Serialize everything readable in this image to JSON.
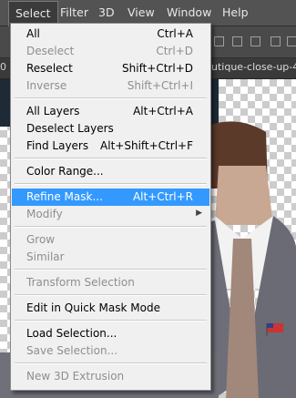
{
  "menubar": {
    "items": [
      "Select",
      "Filter",
      "3D",
      "View",
      "Window",
      "Help"
    ],
    "active": "Select"
  },
  "tabbar": {
    "left_fragment": "0",
    "tab_title": "utique-close-up-4"
  },
  "select_menu": {
    "items": [
      {
        "label": "All",
        "shortcut": "Ctrl+A",
        "enabled": true
      },
      {
        "label": "Deselect",
        "shortcut": "Ctrl+D",
        "enabled": false
      },
      {
        "label": "Reselect",
        "shortcut": "Shift+Ctrl+D",
        "enabled": true
      },
      {
        "label": "Inverse",
        "shortcut": "Shift+Ctrl+I",
        "enabled": false
      },
      {
        "label": "All Layers",
        "shortcut": "Alt+Ctrl+A",
        "enabled": true
      },
      {
        "label": "Deselect Layers",
        "shortcut": "",
        "enabled": true
      },
      {
        "label": "Find Layers",
        "shortcut": "Alt+Shift+Ctrl+F",
        "enabled": true
      },
      {
        "label": "Color Range...",
        "shortcut": "",
        "enabled": true
      },
      {
        "label": "Refine Mask...",
        "shortcut": "Alt+Ctrl+R",
        "enabled": true,
        "highlighted": true
      },
      {
        "label": "Modify",
        "shortcut": "",
        "enabled": false,
        "submenu": true
      },
      {
        "label": "Grow",
        "shortcut": "",
        "enabled": false
      },
      {
        "label": "Similar",
        "shortcut": "",
        "enabled": false
      },
      {
        "label": "Transform Selection",
        "shortcut": "",
        "enabled": false
      },
      {
        "label": "Edit in Quick Mask Mode",
        "shortcut": "",
        "enabled": true
      },
      {
        "label": "Load Selection...",
        "shortcut": "",
        "enabled": true
      },
      {
        "label": "Save Selection...",
        "shortcut": "",
        "enabled": false
      },
      {
        "label": "New 3D Extrusion",
        "shortcut": "",
        "enabled": false
      }
    ]
  },
  "colors": {
    "highlight": "#3399ff",
    "menu_bg": "#f0f0f0",
    "disabled_text": "#8e8e8e",
    "app_bg": "#535353"
  }
}
